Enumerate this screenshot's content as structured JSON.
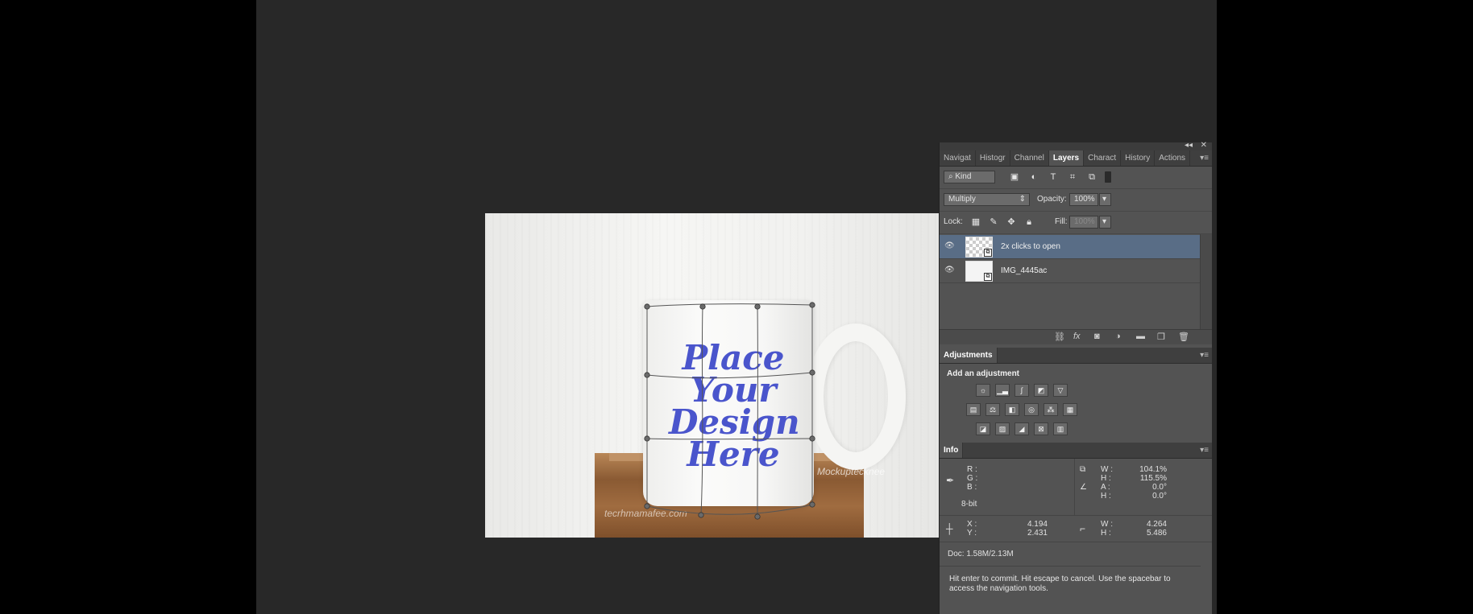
{
  "canvas": {
    "design_lines": [
      "Place",
      "Your",
      "Design",
      "Here"
    ],
    "watermark_bottom": "tecrhmamafee.com",
    "watermark_right": "Mockuptecknee"
  },
  "panel_controls": {
    "collapse": "◂◂",
    "close": "✕"
  },
  "top_tabs": [
    "Navigat",
    "Histogr",
    "Channel",
    "Layers",
    "Charact",
    "History",
    "Actions"
  ],
  "active_tab": "Layers",
  "layers": {
    "filter_kind": "Kind",
    "blend_mode": "Multiply",
    "opacity_label": "Opacity:",
    "opacity_value": "100%",
    "lock_label": "Lock:",
    "fill_label": "Fill:",
    "fill_value": "100%",
    "items": [
      {
        "name": "2x clicks to open",
        "selected": true
      },
      {
        "name": "IMG_4445ac",
        "selected": false
      }
    ]
  },
  "adjustments": {
    "tab": "Adjustments",
    "title": "Add an adjustment"
  },
  "info": {
    "tab": "Info",
    "rgb_labels": [
      "R :",
      "G :",
      "B :"
    ],
    "bitdepth": "8-bit",
    "transform": {
      "w_label": "W :",
      "w": "104.1%",
      "h_label": "H :",
      "h": "115.5%",
      "a_label": "A :",
      "a": "0.0°",
      "h2_label": "H :",
      "h2": "0.0°"
    },
    "cursor": {
      "x_label": "X :",
      "x": "4.194",
      "y_label": "Y :",
      "y": "2.431"
    },
    "size": {
      "w_label": "W :",
      "w": "4.264",
      "h_label": "H :",
      "h": "5.486"
    },
    "doc": "Doc: 1.58M/2.13M",
    "hint": "Hit enter to commit. Hit escape to cancel. Use the spacebar to access the navigation tools."
  }
}
